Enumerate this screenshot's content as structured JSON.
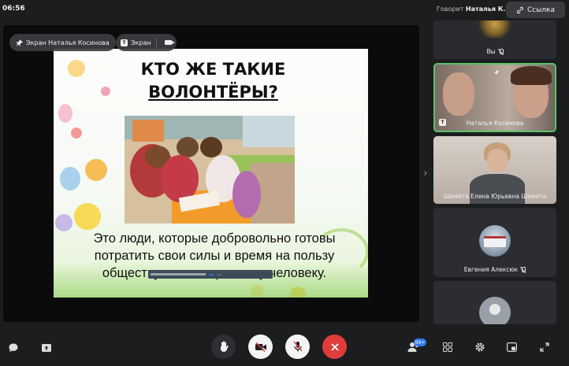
{
  "topbar": {
    "clock": "06:56",
    "speaking_prefix": "Говорит",
    "speaking_name": "Наталья К.",
    "link_label": "Ссылка"
  },
  "stage": {
    "screen_chip_label": "Экран Наталья Косинова",
    "screen_chip2_label": "Экран",
    "slide": {
      "title_line1": "КТО ЖЕ ТАКИЕ",
      "title_line2": "ВОЛОНТЁРЫ?",
      "body_line1": "Это люди, которые добровольно готовы",
      "body_line2": "потратить свои силы и время на пользу",
      "body_line3": "обществу или конкретному человеку."
    }
  },
  "participants": [
    {
      "name": "Вы",
      "mic": "off"
    },
    {
      "name": "Наталья Косинова",
      "active": true
    },
    {
      "name": "Шемета Елена Юрьевна Шемета"
    },
    {
      "name": "Евгения Алексюк",
      "mic": "off"
    },
    {
      "name": ""
    }
  ],
  "toolbar": {
    "participants_count": "99+"
  },
  "colors": {
    "background": "#1c1d1f",
    "active_border": "#58c469",
    "end_call": "#e03c3c",
    "badge": "#2d7cf2"
  },
  "icons": [
    "chat-icon",
    "share-screen-icon",
    "raise-hand-icon",
    "camera-off-icon",
    "mic-off-icon",
    "end-call-icon",
    "participants-icon",
    "grid-layout-icon",
    "settings-icon",
    "picture-in-picture-icon",
    "fullscreen-icon",
    "pin-icon",
    "link-icon"
  ]
}
